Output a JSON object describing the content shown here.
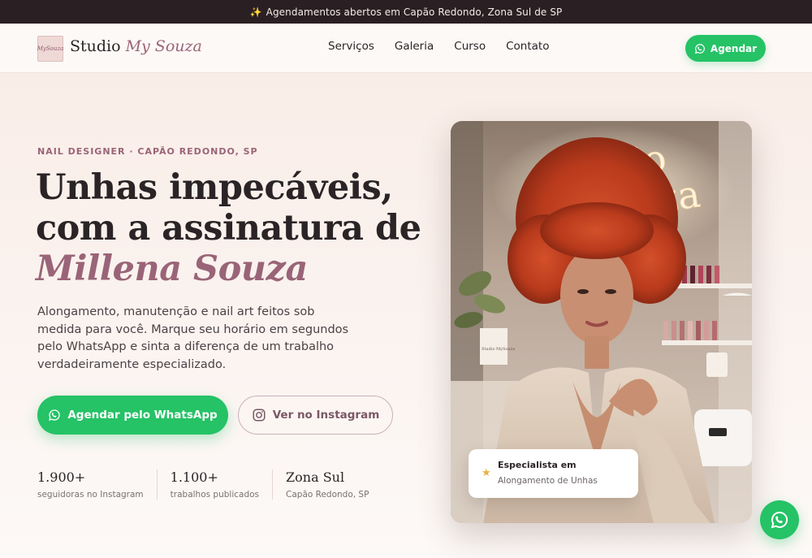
{
  "announcement": {
    "icon": "sparkles-icon",
    "text": "Agendamentos abertos em Capão Redondo, Zona Sul de SP"
  },
  "brand": {
    "logo_text": "MySouza",
    "name_primary": "Studio",
    "name_accent": "My Souza"
  },
  "nav": {
    "items": [
      {
        "label": "Serviços"
      },
      {
        "label": "Galeria"
      },
      {
        "label": "Curso"
      },
      {
        "label": "Contato"
      }
    ],
    "cta_label": "Agendar"
  },
  "hero": {
    "eyebrow": "NAIL DESIGNER · CAPÃO REDONDO, SP",
    "headline_line1": "Unhas impecáveis,",
    "headline_line2": "com a assinatura de",
    "headline_name": "Millena Souza",
    "lead": "Alongamento, manutenção e nail art feitos sob medida para você. Marque seu horário em segundos pelo WhatsApp e sinta a diferença de um trabalho verdadeiramente especializado.",
    "primary_cta": "Agendar pelo WhatsApp",
    "secondary_cta": "Ver no Instagram",
    "stats": [
      {
        "value": "1.900+",
        "label": "seguidoras no Instagram"
      },
      {
        "value": "1.100+",
        "label": "trabalhos publicados"
      },
      {
        "value": "Zona Sul",
        "label": "Capão Redondo, SP"
      }
    ]
  },
  "photo": {
    "sign_line1": "Studio",
    "sign_line2": "MySouza",
    "book_text": "Studio MySouza"
  },
  "badge": {
    "icon": "star-icon",
    "title": "Especialista em",
    "subtitle": "Alongamento de Unhas"
  },
  "colors": {
    "whatsapp": "#25c266",
    "accent": "#9a6478",
    "topbar": "#2a1f23"
  }
}
